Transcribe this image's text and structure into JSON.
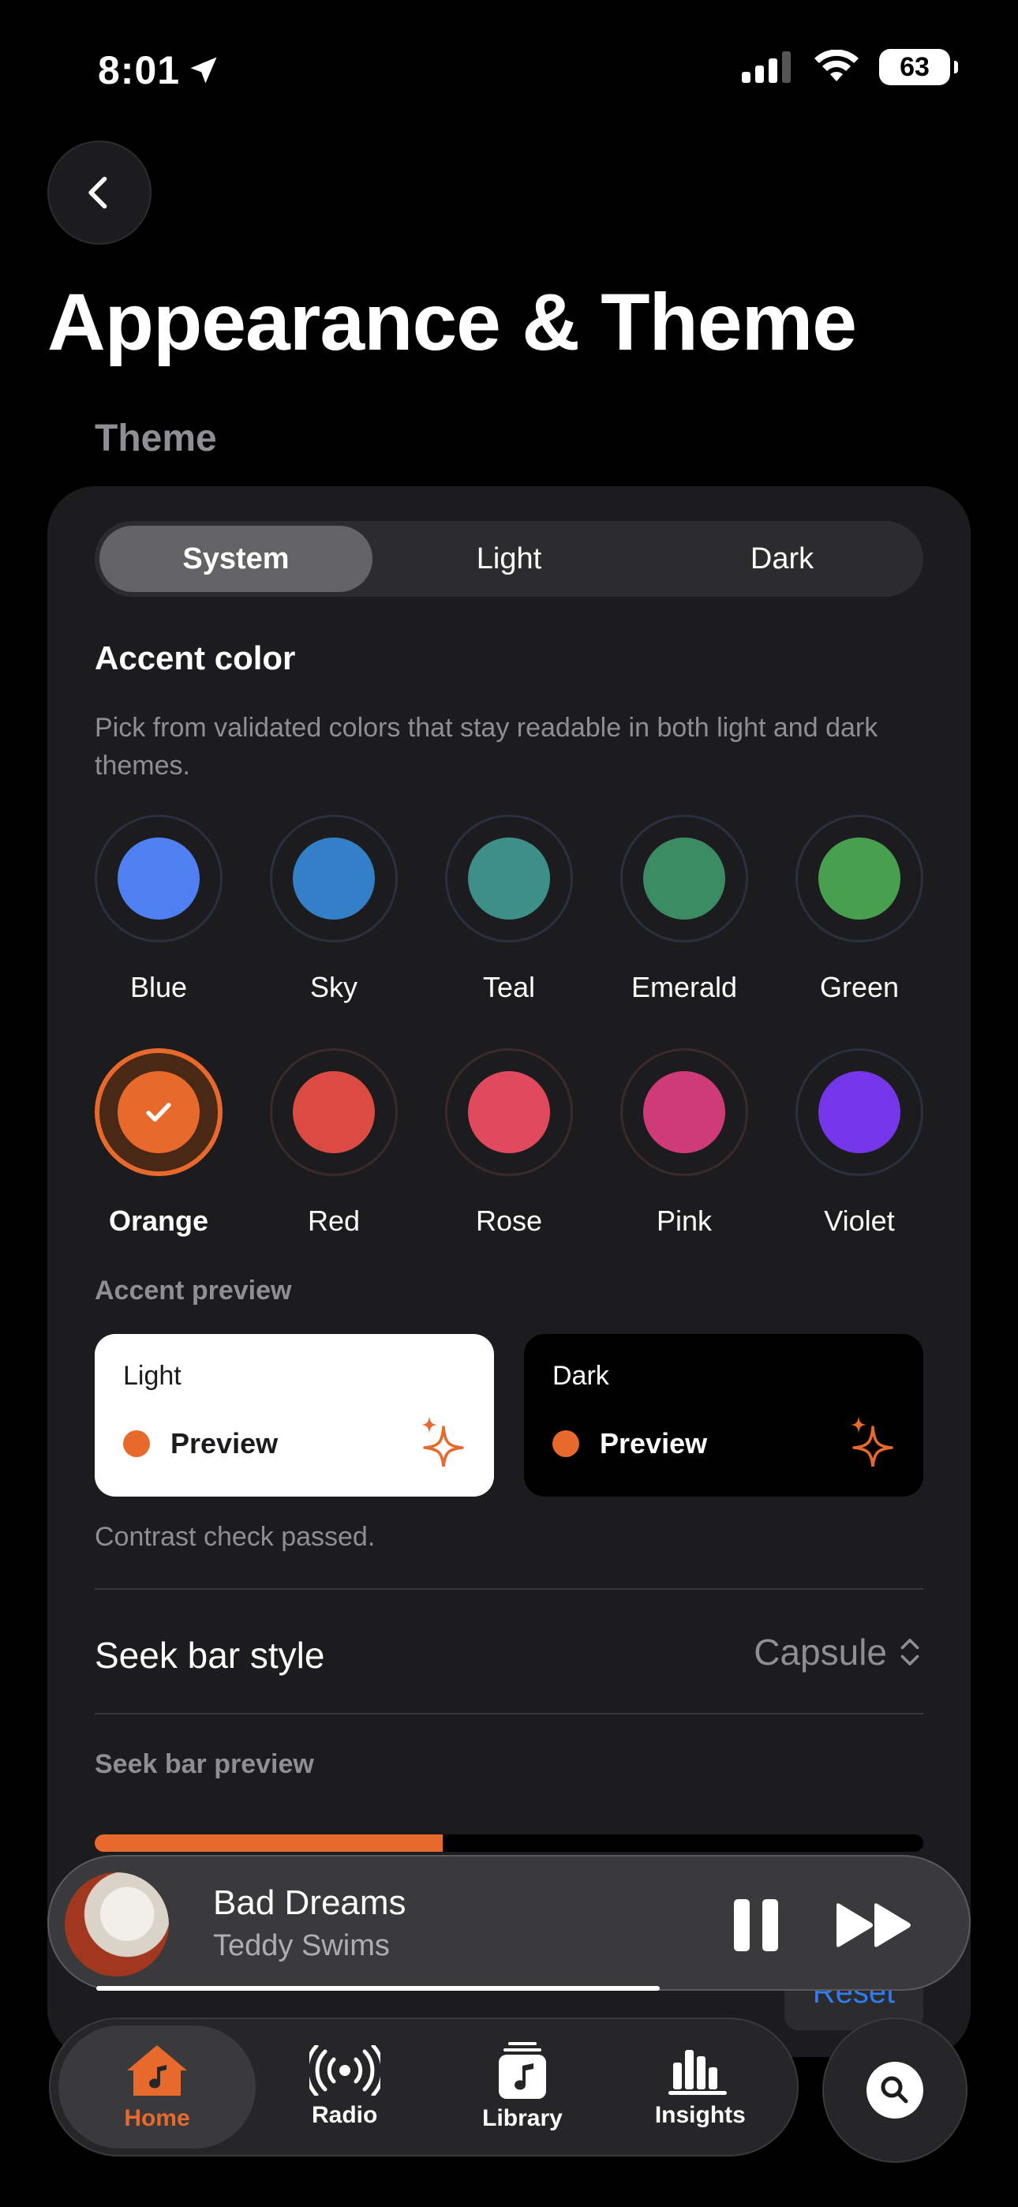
{
  "status_bar": {
    "time": "8:01",
    "battery": "63"
  },
  "page": {
    "title": "Appearance & Theme",
    "section": "Theme"
  },
  "theme_segments": [
    "System",
    "Light",
    "Dark"
  ],
  "accent": {
    "title": "Accent color",
    "description": "Pick from validated colors that stay readable in both light and dark themes.",
    "swatches": [
      {
        "label": "Blue",
        "color": "#4f7ff0"
      },
      {
        "label": "Sky",
        "color": "#3480c8"
      },
      {
        "label": "Teal",
        "color": "#3e8f88"
      },
      {
        "label": "Emerald",
        "color": "#3b8c62"
      },
      {
        "label": "Green",
        "color": "#46a04e"
      },
      {
        "label": "Orange",
        "color": "#e8692c",
        "selected": true
      },
      {
        "label": "Red",
        "color": "#dc4a44"
      },
      {
        "label": "Rose",
        "color": "#e14a5e"
      },
      {
        "label": "Pink",
        "color": "#cf3b78"
      },
      {
        "label": "Violet",
        "color": "#7436e8"
      }
    ]
  },
  "preview": {
    "label": "Accent preview",
    "light_title": "Light",
    "dark_title": "Dark",
    "item_label": "Preview",
    "contrast": "Contrast check passed."
  },
  "seek_bar": {
    "label": "Seek bar style",
    "value": "Capsule",
    "preview_label": "Seek bar preview",
    "reset_label": "Reset",
    "progress": 0.42
  },
  "now_playing": {
    "title": "Bad Dreams",
    "artist": "Teddy Swims",
    "progress": 0.68
  },
  "tabs": [
    {
      "label": "Home",
      "icon": "home-icon",
      "active": true
    },
    {
      "label": "Radio",
      "icon": "radio-icon"
    },
    {
      "label": "Library",
      "icon": "library-icon"
    },
    {
      "label": "Insights",
      "icon": "insights-icon"
    }
  ],
  "colors": {
    "accent": "#e8692c",
    "background": "#000000",
    "card": "#1c1c1e"
  }
}
